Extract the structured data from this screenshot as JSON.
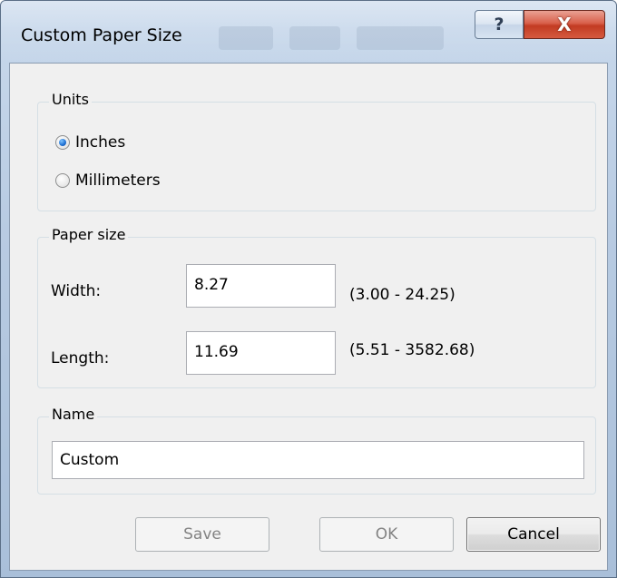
{
  "window": {
    "title": "Custom Paper Size",
    "help_label": "?",
    "close_label": "X"
  },
  "units": {
    "legend": "Units",
    "options": [
      {
        "label": "Inches",
        "checked": true
      },
      {
        "label": "Millimeters",
        "checked": false
      }
    ]
  },
  "paper_size": {
    "legend": "Paper size",
    "width_label": "Width:",
    "width_value": "8.27",
    "width_range": "(3.00 - 24.25)",
    "length_label": "Length:",
    "length_value": "11.69",
    "length_range": "(5.51 - 3582.68)"
  },
  "name": {
    "legend": "Name",
    "value": "Custom"
  },
  "buttons": {
    "save": "Save",
    "ok": "OK",
    "cancel": "Cancel"
  },
  "colors": {
    "close_button": "#c9432b",
    "radio_selected": "#1e6fd2",
    "dialog_bg": "#f0f0f0"
  }
}
